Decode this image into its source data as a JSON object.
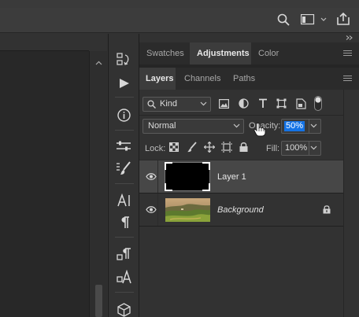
{
  "colors": {
    "accent": "#1473e6",
    "panel_bg": "#323232",
    "selected_row": "#474747"
  },
  "top_toolbar": {
    "icons": [
      "search-icon",
      "workspace-icon",
      "share-icon"
    ]
  },
  "panel_group_top": {
    "tabs": [
      {
        "label": "Swatches"
      },
      {
        "label": "Adjustments",
        "active": true
      },
      {
        "label": "Color"
      }
    ]
  },
  "layers_panel": {
    "tabs": [
      {
        "label": "Layers",
        "active": true
      },
      {
        "label": "Channels"
      },
      {
        "label": "Paths"
      }
    ],
    "filter": {
      "label": "Kind"
    },
    "blend_mode": "Normal",
    "opacity": {
      "label": "Opacity:",
      "value": "50%"
    },
    "lock_label": "Lock:",
    "fill": {
      "label": "Fill:",
      "value": "100%"
    },
    "layers": [
      {
        "name": "Layer 1",
        "visible": true,
        "selected": true,
        "locked": false
      },
      {
        "name": "Background",
        "visible": true,
        "selected": false,
        "locked": true
      }
    ]
  },
  "tools": [
    "history-play-icon",
    "play-icon",
    "info-icon",
    "adjustments-icon",
    "brushes-icon",
    "character-icon",
    "paragraph-icon",
    "paragraph-styles-icon",
    "character-styles-icon",
    "3d-icon"
  ]
}
